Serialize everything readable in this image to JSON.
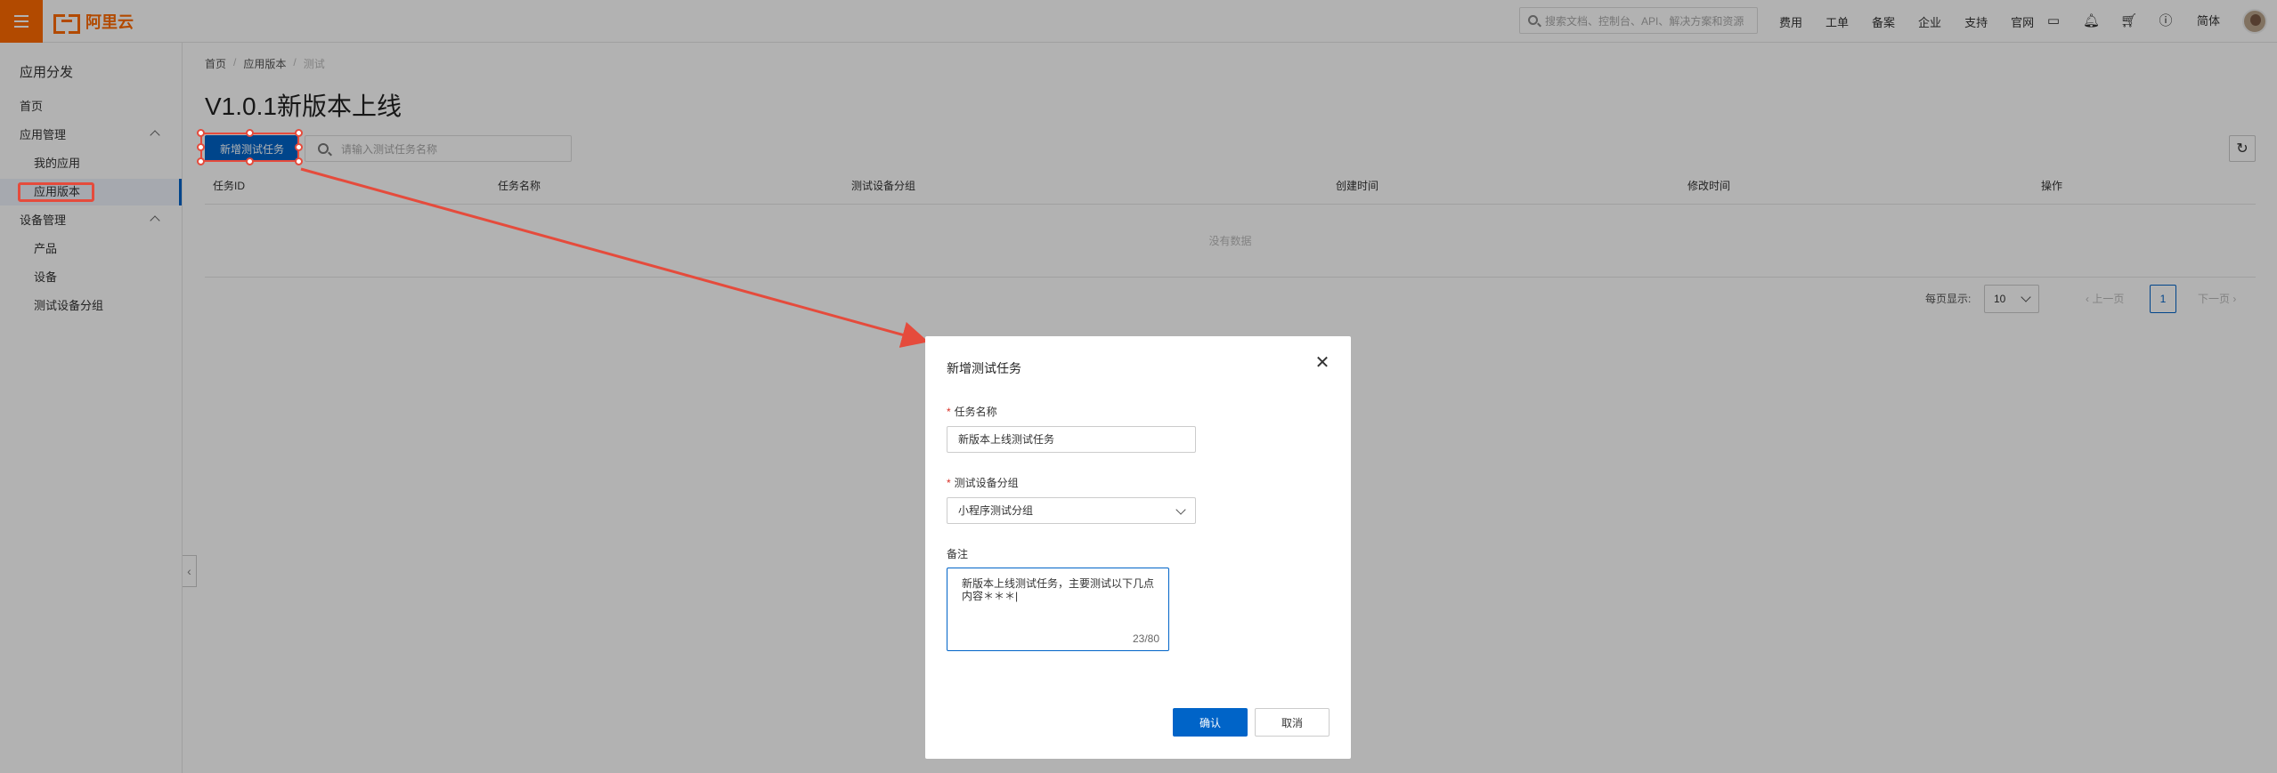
{
  "brand": {
    "name": "阿里云"
  },
  "topbar": {
    "search_placeholder": "搜索文档、控制台、API、解决方案和资源",
    "nav": [
      "费用",
      "工单",
      "备案",
      "企业",
      "支持",
      "官网"
    ],
    "lang": "简体"
  },
  "sidebar": {
    "title": "应用分发",
    "items": [
      {
        "label": "首页"
      },
      {
        "label": "应用管理"
      },
      {
        "label": "我的应用"
      },
      {
        "label": "应用版本"
      },
      {
        "label": "设备管理"
      },
      {
        "label": "产品"
      },
      {
        "label": "设备"
      },
      {
        "label": "测试设备分组"
      }
    ]
  },
  "breadcrumb": [
    "首页",
    "应用版本",
    "测试"
  ],
  "page": {
    "title": "V1.0.1新版本上线",
    "add_button": "新增测试任务",
    "search_placeholder": "请输入测试任务名称"
  },
  "table": {
    "columns": [
      "任务ID",
      "任务名称",
      "测试设备分组",
      "创建时间",
      "修改时间",
      "操作"
    ],
    "empty_text": "没有数据"
  },
  "pagination": {
    "page_size_label": "每页显示:",
    "page_size": "10",
    "prev": "上一页",
    "current": "1",
    "next": "下一页"
  },
  "dialog": {
    "title": "新增测试任务",
    "task_name_label": "任务名称",
    "task_name_value": "新版本上线测试任务",
    "group_label": "测试设备分组",
    "group_value": "小程序测试分组",
    "note_label": "备注",
    "note_value": "新版本上线测试任务，主要测试以下几点内容＊＊＊|",
    "note_count": "23/80",
    "confirm": "确认",
    "cancel": "取消"
  },
  "colors": {
    "accent": "#0064c8",
    "brand": "#ff6a00",
    "annotation": "#e54b3c"
  },
  "icons": [
    "menu-icon",
    "search-icon",
    "terminal-icon",
    "bell-icon",
    "cart-icon",
    "help-icon",
    "refresh-icon",
    "close-icon"
  ]
}
